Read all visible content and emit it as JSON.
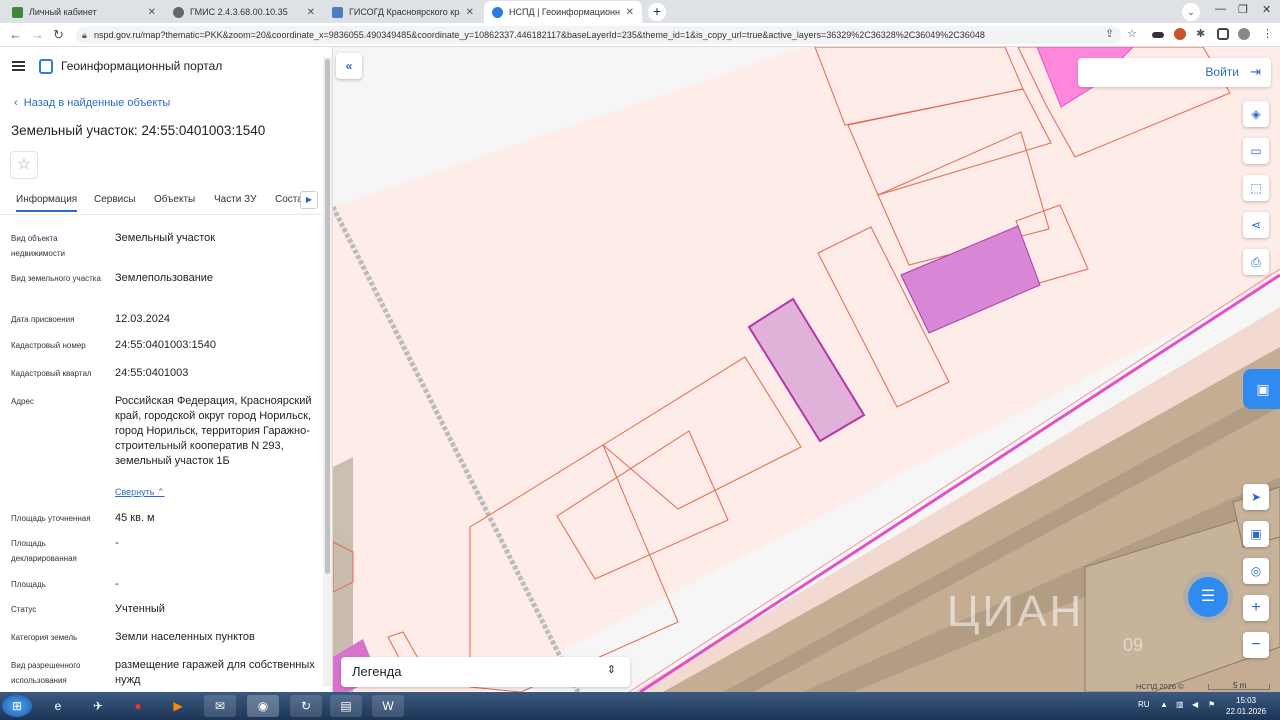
{
  "browser": {
    "tabs": [
      {
        "title": "Личный кабинет",
        "color": "#3a8a3a"
      },
      {
        "title": "ГМИС 2.4.3.68.00.10.35",
        "color": "#666666"
      },
      {
        "title": "ГИСОГД Красноярского края",
        "color": "#4a7fc0"
      },
      {
        "title": "НСПД | Геоинформационный п",
        "color": "#2a7be4"
      }
    ],
    "url": "nspd.gov.ru/map?thematic=PKK&zoom=20&coordinate_x=9836055.490349485&coordinate_y=10862337.446182117&baseLayerId=235&theme_id=1&is_copy_url=true&active_layers=36329%2C36328%2C36049%2C36048"
  },
  "panel": {
    "portal_title": "Геоинформационный портал",
    "back_link": "Назад в найденные объекты",
    "object_title": "Земельный участок: 24:55:0401003:1540",
    "tabs": [
      "Информация",
      "Сервисы",
      "Объекты",
      "Части ЗУ",
      "Соста"
    ],
    "rows": [
      {
        "label": "Вид объекта недвижимости",
        "value": "Земельный участок"
      },
      {
        "label": "Вид земельного участка",
        "value": "Землепользование"
      },
      {
        "label": "Дата присвоения",
        "value": "12.03.2024"
      },
      {
        "label": "Кадастровый номер",
        "value": "24:55:0401003:1540"
      },
      {
        "label": "Кадастровый квартал",
        "value": "24:55:0401003"
      },
      {
        "label": "Адрес",
        "value": "Российская Федерация, Красноярский край, городской округ город Норильск, город Норильск, территория Гаражно-строительный кооператив N 293, земельный участок 1Б"
      },
      {
        "label": "Площадь уточненная",
        "value": "45 кв. м"
      },
      {
        "label": "Площадь декларированная",
        "value": "-"
      },
      {
        "label": "Площадь",
        "value": "-"
      },
      {
        "label": "Статус",
        "value": "Учтенный"
      },
      {
        "label": "Категория земель",
        "value": "Земли населенных пунктов"
      },
      {
        "label": "Вид разрешенного использования",
        "value": "размещение гаражей для собственных нужд"
      }
    ],
    "collapse_link": "Свернуть"
  },
  "map": {
    "login_label": "Войти",
    "legend_label": "Легенда",
    "copyright": "НСПД 2026 ©",
    "scale_label": "5 m",
    "watermark": "ЦИАН",
    "watermark_sub": "09"
  },
  "taskbar": {
    "lang": "RU",
    "time": "15:03",
    "date": "22.01.2026"
  }
}
